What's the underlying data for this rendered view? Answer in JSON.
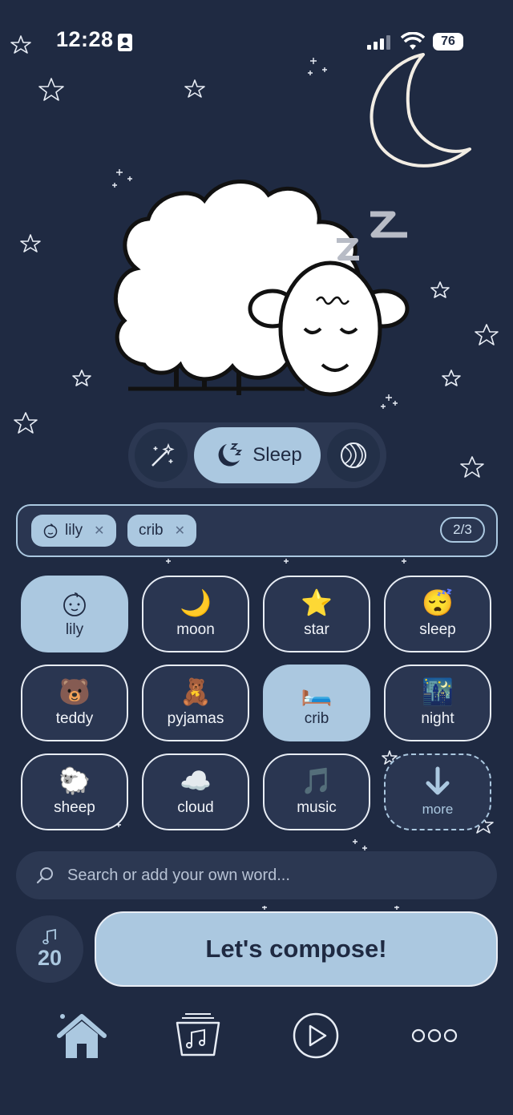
{
  "status_bar": {
    "time": "12:28",
    "battery": "76"
  },
  "mode": {
    "active_label": "Sleep",
    "left_icon": "magic-wand-icon",
    "right_icon": "ball-icon"
  },
  "selected_chips": [
    {
      "label": "lily",
      "icon": "baby-face-icon"
    },
    {
      "label": "crib"
    }
  ],
  "selection_count": "2/3",
  "words": [
    {
      "label": "lily",
      "emoji": "baby-face-icon",
      "selected": true
    },
    {
      "label": "moon",
      "emoji": "🌙"
    },
    {
      "label": "star",
      "emoji": "⭐"
    },
    {
      "label": "sleep",
      "emoji": "😴"
    },
    {
      "label": "teddy",
      "emoji": "🐻"
    },
    {
      "label": "pyjamas",
      "emoji": "🧸"
    },
    {
      "label": "crib",
      "emoji": "🛏️",
      "selected": true
    },
    {
      "label": "night",
      "emoji": "🌃"
    },
    {
      "label": "sheep",
      "emoji": "🐑"
    },
    {
      "label": "cloud",
      "emoji": "☁️"
    },
    {
      "label": "music",
      "emoji": "🎵"
    },
    {
      "label": "more",
      "emoji": "arrow-down-icon"
    }
  ],
  "search": {
    "placeholder": "Search or add your own word..."
  },
  "credits": {
    "value": "20",
    "icon": "music-note-icon"
  },
  "compose_label": "Let's compose!",
  "nav": [
    "home-icon",
    "library-icon",
    "play-icon",
    "more-icon"
  ],
  "colors": {
    "background": "#1f2a42",
    "accent": "#abc8e0",
    "surface": "#2c3852"
  }
}
